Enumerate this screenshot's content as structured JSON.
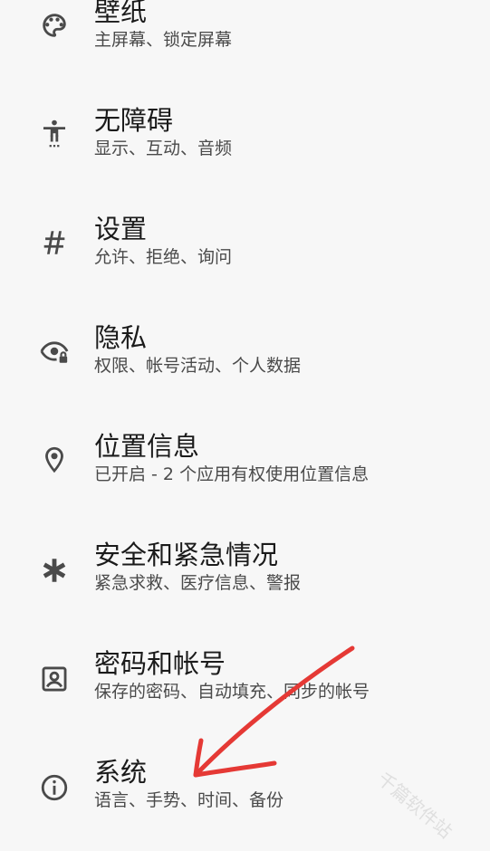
{
  "settings": {
    "items": [
      {
        "id": "wallpaper",
        "title": "壁纸",
        "subtitle": "主屏幕、锁定屏幕",
        "icon": "palette-icon"
      },
      {
        "id": "accessibility",
        "title": "无障碍",
        "subtitle": "显示、互动、音频",
        "icon": "accessibility-icon"
      },
      {
        "id": "settings",
        "title": "设置",
        "subtitle": "允许、拒绝、询问",
        "icon": "hash-icon"
      },
      {
        "id": "privacy",
        "title": "隐私",
        "subtitle": "权限、帐号活动、个人数据",
        "icon": "privacy-eye-icon"
      },
      {
        "id": "location",
        "title": "位置信息",
        "subtitle": "已开启 - 2 个应用有权使用位置信息",
        "icon": "location-pin-icon"
      },
      {
        "id": "safety",
        "title": "安全和紧急情况",
        "subtitle": "紧急求救、医疗信息、警报",
        "icon": "asterisk-icon"
      },
      {
        "id": "passwords",
        "title": "密码和帐号",
        "subtitle": "保存的密码、自动填充、同步的帐号",
        "icon": "account-box-icon"
      },
      {
        "id": "system",
        "title": "系统",
        "subtitle": "语言、手势、时间、备份",
        "icon": "info-icon"
      }
    ]
  },
  "annotation": {
    "arrow_color": "#e53935"
  },
  "watermark": {
    "text": "千篇软件站"
  },
  "colors": {
    "background": "#f7f7f7",
    "icon": "#4a4a4a",
    "title": "#1b1b1b",
    "subtitle": "#4a4a4a"
  }
}
